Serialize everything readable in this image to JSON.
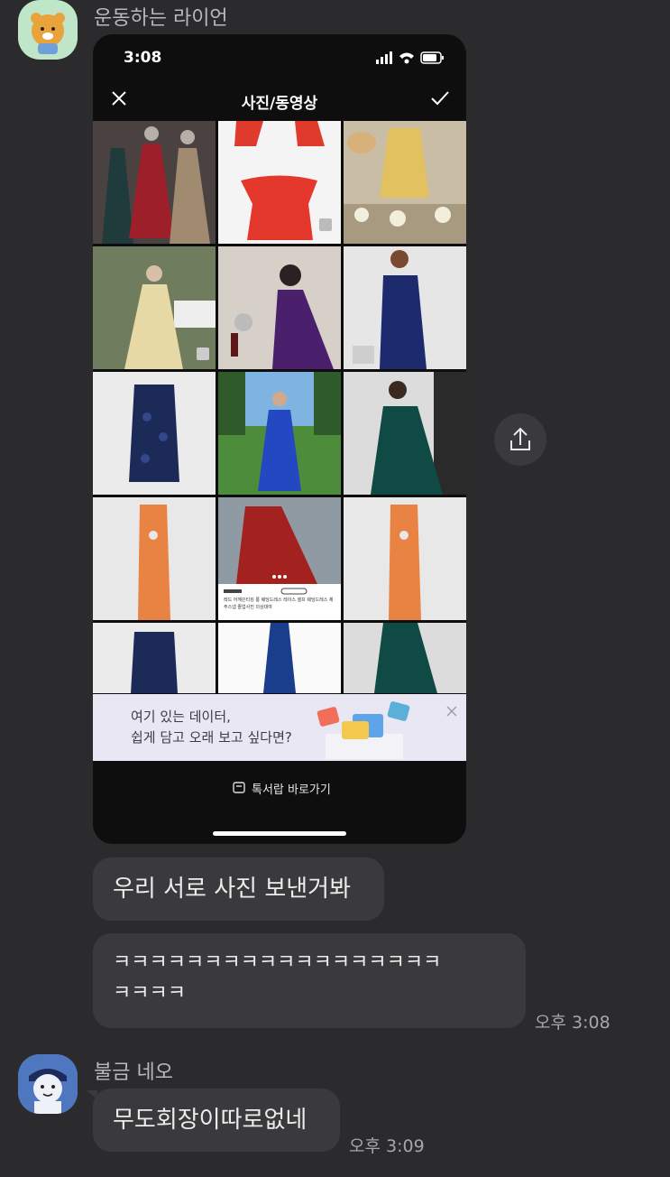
{
  "chat": {
    "messages": [
      {
        "sender": "운동하는 라이언",
        "text": "우리 서로 사진 보낸거봐"
      },
      {
        "text_line1": "ㅋㅋㅋㅋㅋㅋㅋㅋㅋㅋㅋㅋㅋㅋㅋㅋㅋㅋ",
        "text_line2": "ㅋㅋㅋㅋ",
        "time": "오후 3:08"
      },
      {
        "sender": "불금 네오",
        "text": "무도회장이따로없네",
        "time": "오후 3:09"
      }
    ]
  },
  "screenshot": {
    "status_time": "3:08",
    "title": "사진/동영상",
    "banner_line1": "여기 있는 데이터,",
    "banner_line2": "쉽게 담고 오래 보고 싶다면?",
    "drawer_label": "톡서랍 바로가기",
    "card_title": "레드 어깨끈티킹 롱 웨딩드레스 레이스 셀프 웨딩드레스 제주스냅 졸업사진 의상대여"
  },
  "colors": {
    "background": "#2b2b2d",
    "bubble": "#3a3a3c",
    "phone_bg": "#0e0e0f",
    "banner_bg": "#e9e7f3"
  },
  "icons": [
    "ryan-avatar",
    "neo-avatar",
    "close-icon",
    "check-icon",
    "share-icon",
    "drawer-icon",
    "banner-close-icon",
    "gallery-badge-icon"
  ]
}
